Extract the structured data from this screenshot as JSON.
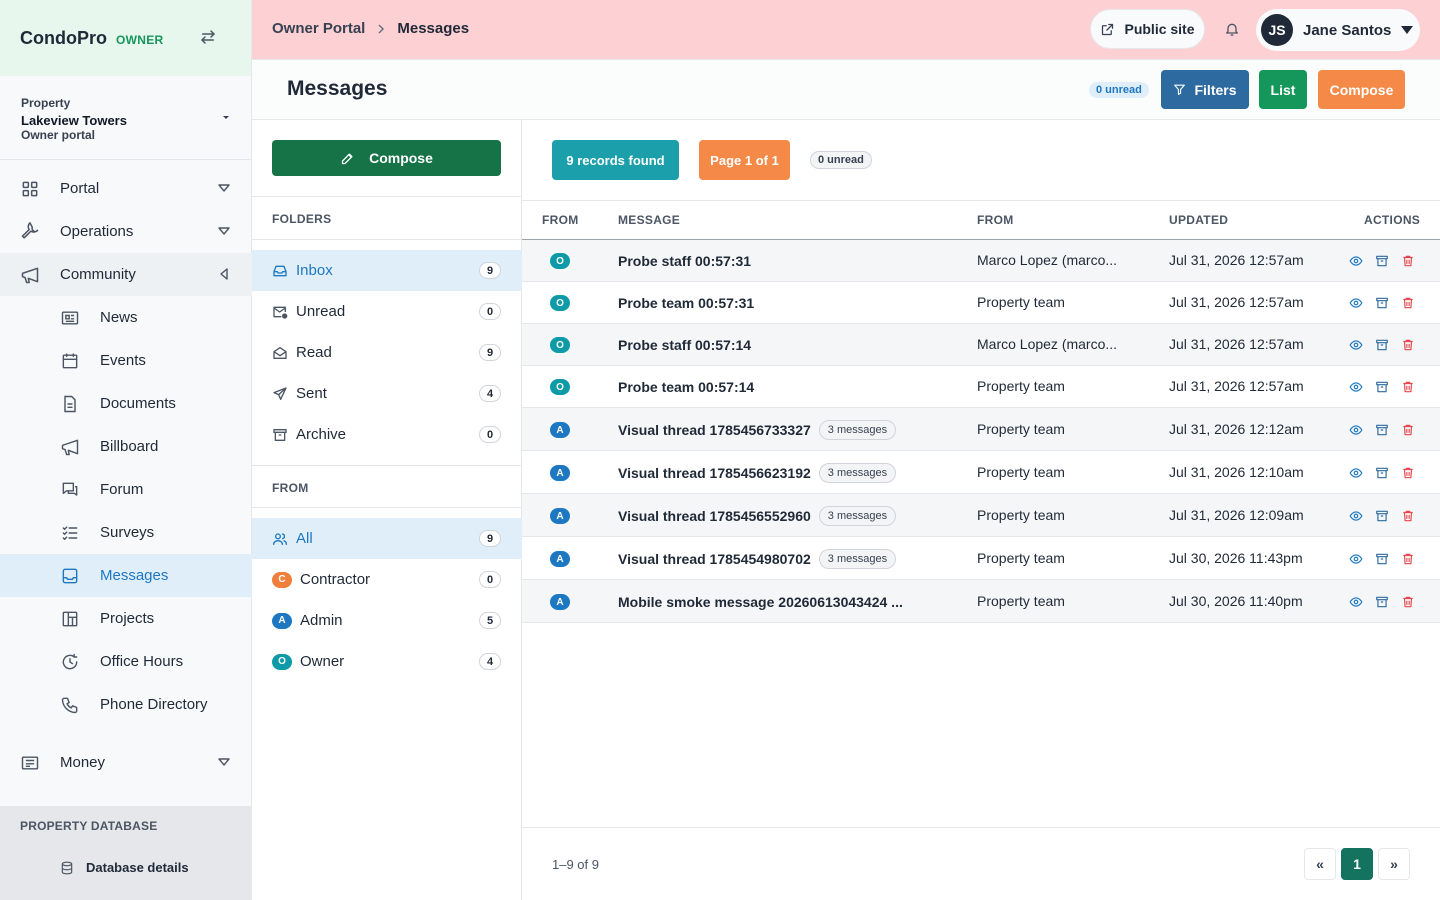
{
  "brand": {
    "name": "CondoPro",
    "role": "OWNER"
  },
  "property": {
    "label": "Property",
    "name": "Lakeview Towers",
    "sub": "Owner portal"
  },
  "nav": {
    "top": [
      {
        "label": "Portal",
        "icon": "grid-icon"
      },
      {
        "label": "Operations",
        "icon": "wrench-icon"
      },
      {
        "label": "Community",
        "icon": "megaphone-icon"
      }
    ],
    "community_items": [
      {
        "label": "News",
        "icon": "newspaper-icon"
      },
      {
        "label": "Events",
        "icon": "calendar-icon"
      },
      {
        "label": "Documents",
        "icon": "document-icon"
      },
      {
        "label": "Billboard",
        "icon": "megaphone-icon"
      },
      {
        "label": "Forum",
        "icon": "chat-icon"
      },
      {
        "label": "Surveys",
        "icon": "checklist-icon"
      },
      {
        "label": "Messages",
        "icon": "inbox-icon"
      },
      {
        "label": "Projects",
        "icon": "projects-icon"
      },
      {
        "label": "Office Hours",
        "icon": "clock-icon"
      },
      {
        "label": "Phone Directory",
        "icon": "phone-icon"
      }
    ],
    "money": {
      "label": "Money",
      "icon": "receipt-icon"
    },
    "db_section": "PROPERTY DATABASE",
    "db_item": "Database details"
  },
  "topbar": {
    "breadcrumb_root": "Owner Portal",
    "breadcrumb_current": "Messages",
    "public_site": "Public site",
    "user_initials": "JS",
    "user_name": "Jane Santos"
  },
  "header": {
    "title": "Messages",
    "unread": "0 unread",
    "filters": "Filters",
    "list": "List",
    "compose": "Compose"
  },
  "folders_panel": {
    "compose": "Compose",
    "folders_title": "FOLDERS",
    "folders": [
      {
        "label": "Inbox",
        "count": "9",
        "icon": "inbox-icon"
      },
      {
        "label": "Unread",
        "count": "0",
        "icon": "mail-unread-icon"
      },
      {
        "label": "Read",
        "count": "9",
        "icon": "mail-open-icon"
      },
      {
        "label": "Sent",
        "count": "4",
        "icon": "send-icon"
      },
      {
        "label": "Archive",
        "count": "0",
        "icon": "archive-icon"
      }
    ],
    "from_title": "FROM",
    "from": [
      {
        "label": "All",
        "count": "9",
        "badge": ""
      },
      {
        "label": "Contractor",
        "count": "0",
        "badge": "C",
        "color": "#f07f3c"
      },
      {
        "label": "Admin",
        "count": "5",
        "badge": "A",
        "color": "#1d78c1"
      },
      {
        "label": "Owner",
        "count": "4",
        "badge": "O",
        "color": "#0e9aa7"
      }
    ]
  },
  "summary": {
    "records": "9 records found",
    "page": "Page 1 of 1",
    "unread": "0 unread"
  },
  "table": {
    "columns": [
      "FROM",
      "MESSAGE",
      "FROM",
      "UPDATED",
      "ACTIONS"
    ],
    "rows": [
      {
        "badge": "O",
        "message": "Probe staff 00:57:31",
        "count": "",
        "from": "Marco Lopez (marco...",
        "updated": "Jul 31, 2026 12:57am"
      },
      {
        "badge": "O",
        "message": "Probe team 00:57:31",
        "count": "",
        "from": "Property team",
        "updated": "Jul 31, 2026 12:57am"
      },
      {
        "badge": "O",
        "message": "Probe staff 00:57:14",
        "count": "",
        "from": "Marco Lopez (marco...",
        "updated": "Jul 31, 2026 12:57am"
      },
      {
        "badge": "O",
        "message": "Probe team 00:57:14",
        "count": "",
        "from": "Property team",
        "updated": "Jul 31, 2026 12:57am"
      },
      {
        "badge": "A",
        "message": "Visual thread 1785456733327",
        "count": "3 messages",
        "from": "Property team",
        "updated": "Jul 31, 2026 12:12am"
      },
      {
        "badge": "A",
        "message": "Visual thread 1785456623192",
        "count": "3 messages",
        "from": "Property team",
        "updated": "Jul 31, 2026 12:10am"
      },
      {
        "badge": "A",
        "message": "Visual thread 1785456552960",
        "count": "3 messages",
        "from": "Property team",
        "updated": "Jul 31, 2026 12:09am"
      },
      {
        "badge": "A",
        "message": "Visual thread 1785454980702",
        "count": "3 messages",
        "from": "Property team",
        "updated": "Jul 30, 2026 11:43pm"
      },
      {
        "badge": "A",
        "message": "Mobile smoke message 20260613043424 ...",
        "count": "",
        "from": "Property team",
        "updated": "Jul 30, 2026 11:40pm"
      }
    ]
  },
  "footer": {
    "range": "1–9 of 9",
    "first": "«",
    "page": "1",
    "last": "»"
  },
  "colors": {
    "owner": "#0e9aa7",
    "admin": "#1d78c1",
    "contractor": "#f07f3c",
    "green": "#157347",
    "orange": "#f58a48",
    "teal": "#1a9fab",
    "blue": "#2d6a9f"
  }
}
